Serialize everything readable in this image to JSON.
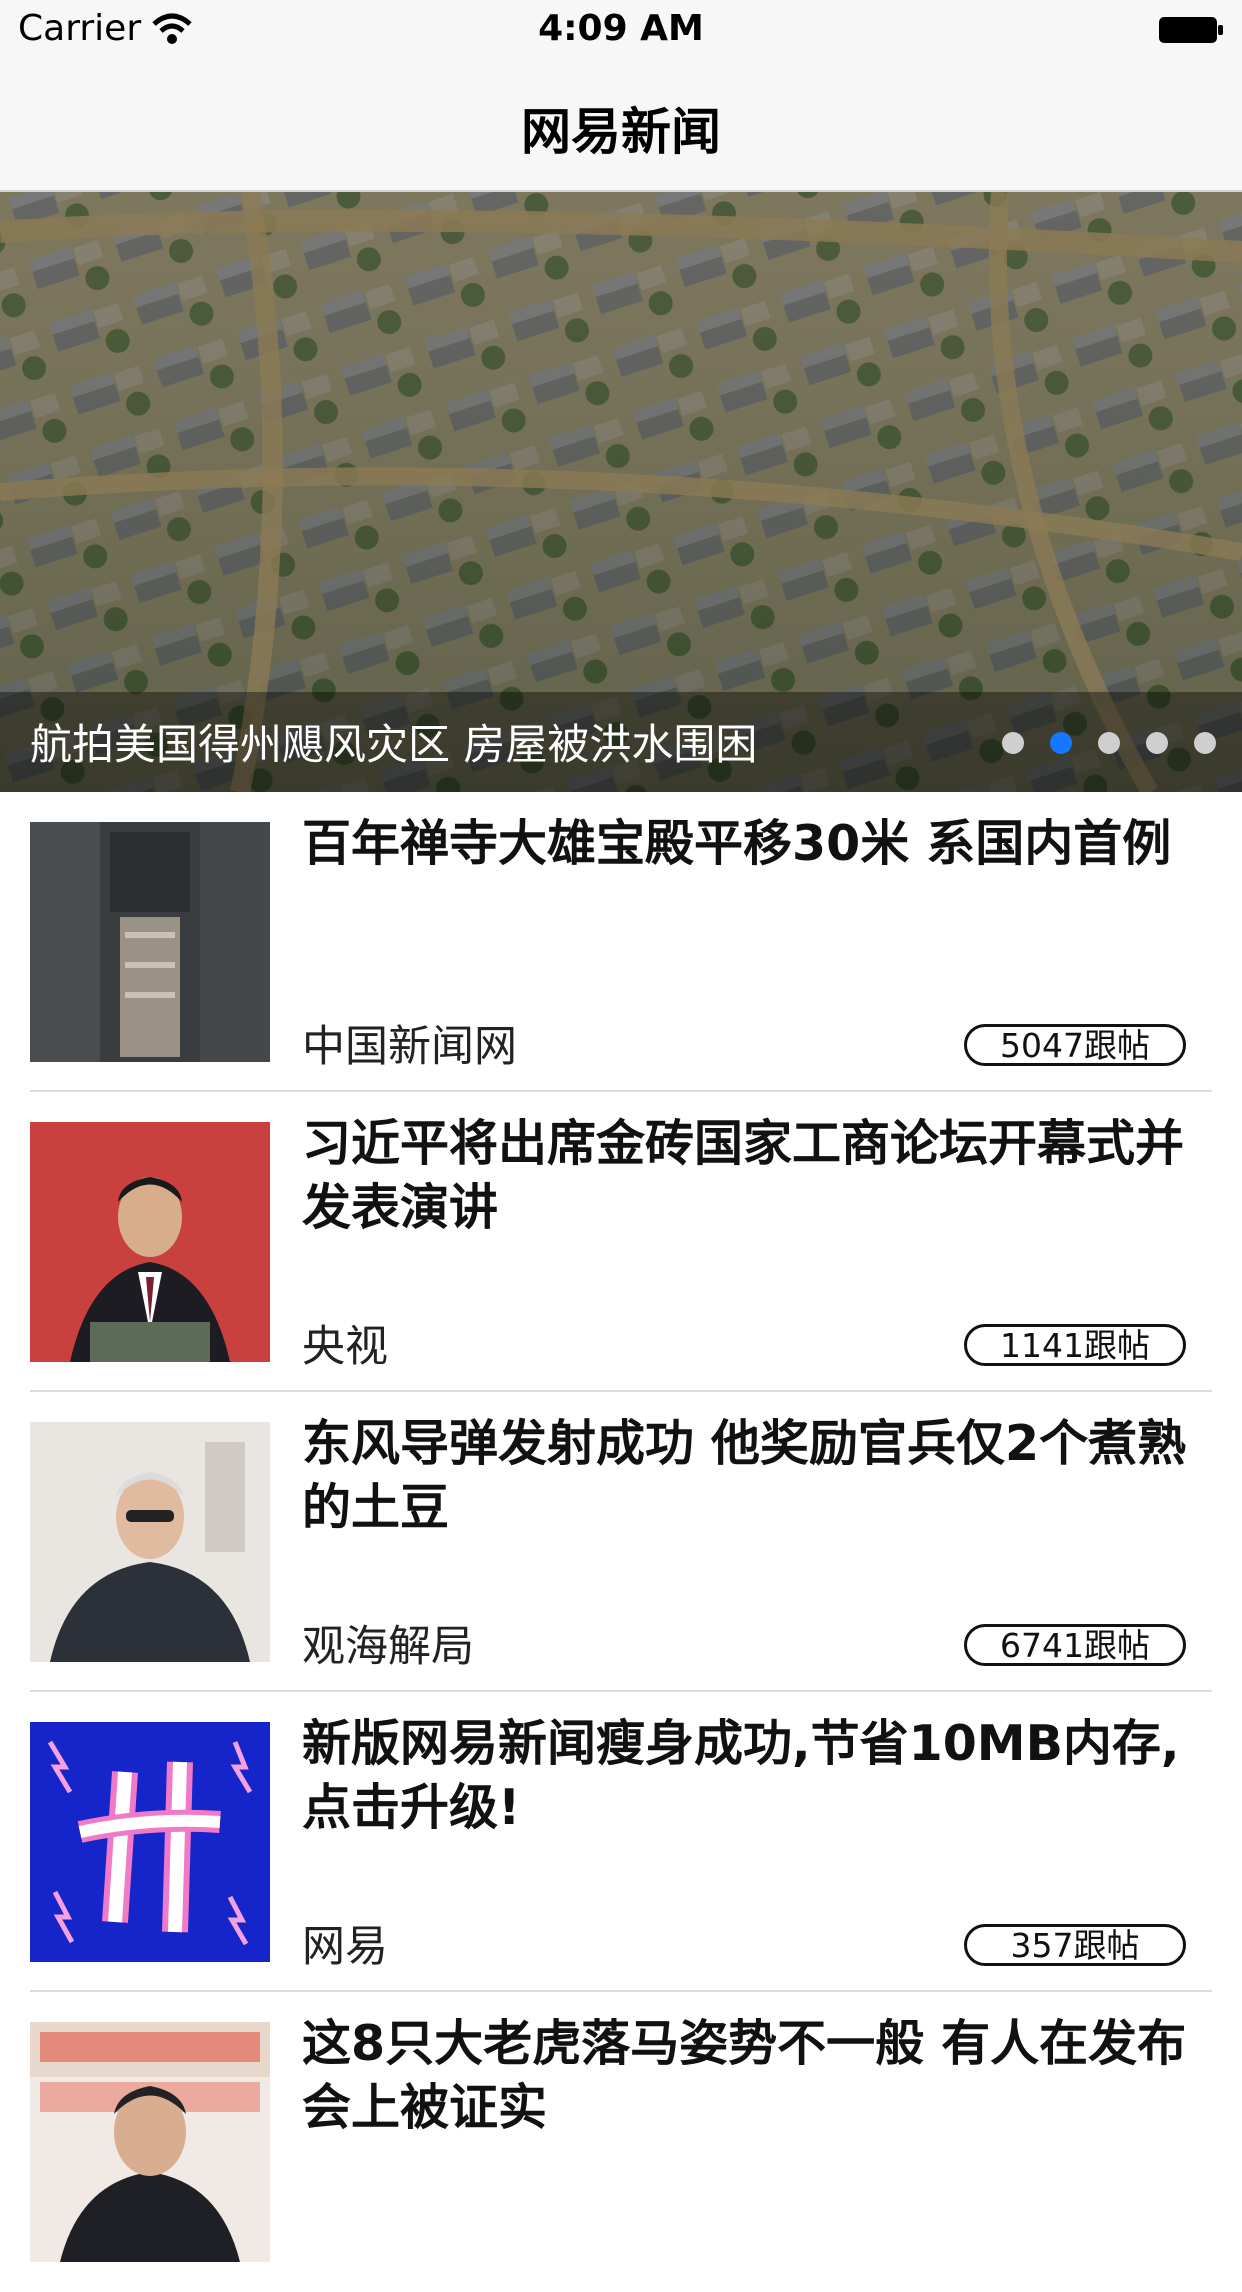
{
  "status_bar": {
    "carrier": "Carrier",
    "time": "4:09 AM"
  },
  "nav": {
    "title": "网易新闻"
  },
  "banner": {
    "caption": "航拍美国得州飓风灾区 房屋被洪水围困",
    "page_count": 5,
    "active_page": 2
  },
  "news": [
    {
      "title": "百年禅寺大雄宝殿平移30米 系国内首例",
      "source": "中国新闻网",
      "replies": "5047跟帖"
    },
    {
      "title": "习近平将出席金砖国家工商论坛开幕式并发表演讲",
      "source": "央视",
      "replies": "1141跟帖"
    },
    {
      "title": "东风导弹发射成功 他奖励官兵仅2个煮熟的土豆",
      "source": "观海解局",
      "replies": "6741跟帖"
    },
    {
      "title": "新版网易新闻瘦身成功,节省10MB内存,点击升级!",
      "source": "网易",
      "replies": "357跟帖"
    },
    {
      "title": "这8只大老虎落马姿势不一般 有人在发布会上被证实",
      "source": "",
      "replies": ""
    }
  ],
  "colors": {
    "accent": "#1479ff",
    "bar_bg": "#f7f7f7"
  }
}
